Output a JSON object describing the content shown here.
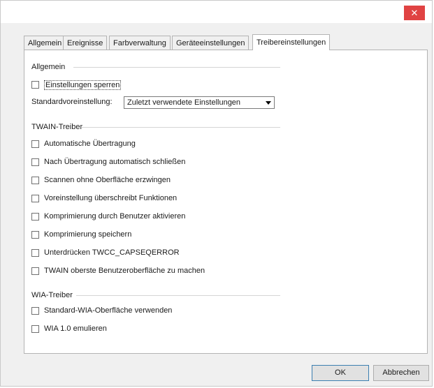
{
  "window": {
    "close_glyph": "✕"
  },
  "tabs": [
    {
      "label": "Allgemein"
    },
    {
      "label": "Ereignisse"
    },
    {
      "label": "Farbverwaltung"
    },
    {
      "label": "Geräteeinstellungen"
    },
    {
      "label": "Treibereinstellungen",
      "active": true
    }
  ],
  "general": {
    "title": "Allgemein",
    "lock_label": "Einstellungen sperren",
    "lock_checked": false,
    "default_label": "Standardvoreinstellung:",
    "default_value": "Zuletzt verwendete Einstellungen"
  },
  "twain": {
    "title": "TWAIN-Treiber",
    "options": [
      {
        "label": "Automatische Übertragung",
        "checked": false
      },
      {
        "label": "Nach Übertragung automatisch schließen",
        "checked": false
      },
      {
        "label": "Scannen ohne Oberfläche erzwingen",
        "checked": false
      },
      {
        "label": "Voreinstellung überschreibt Funktionen",
        "checked": false
      },
      {
        "label": "Komprimierung durch Benutzer aktivieren",
        "checked": false
      },
      {
        "label": "Komprimierung speichern",
        "checked": false
      },
      {
        "label": "Unterdrücken TWCC_CAPSEQERROR",
        "checked": false
      },
      {
        "label": "TWAIN oberste Benutzeroberfläche zu machen",
        "checked": false
      }
    ]
  },
  "wia": {
    "title": "WIA-Treiber",
    "options": [
      {
        "label": "Standard-WIA-Oberfläche verwenden",
        "checked": false
      },
      {
        "label": "WIA 1.0 emulieren",
        "checked": false
      }
    ]
  },
  "buttons": {
    "ok": "OK",
    "cancel": "Abbrechen"
  }
}
